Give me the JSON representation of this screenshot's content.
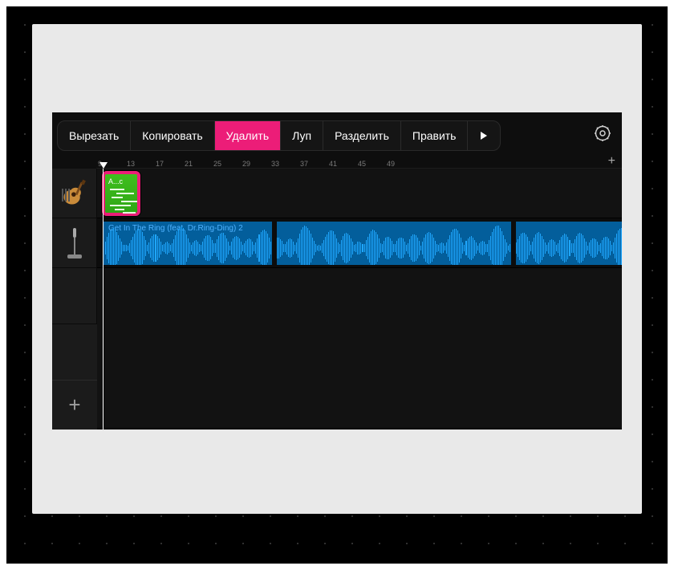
{
  "colors": {
    "accent": "#ec1d78",
    "clip_green": "#3fbf1e",
    "wave_blue": "#1fa7ff"
  },
  "context_menu": {
    "items": [
      {
        "label": "Вырезать",
        "highlighted": false
      },
      {
        "label": "Копировать",
        "highlighted": false
      },
      {
        "label": "Удалить",
        "highlighted": true
      },
      {
        "label": "Луп",
        "highlighted": false
      },
      {
        "label": "Разделить",
        "highlighted": false
      },
      {
        "label": "Править",
        "highlighted": false
      }
    ],
    "more_icon": "play-triangle"
  },
  "toolbar_icons": {
    "settings": "gear-icon"
  },
  "ruler": {
    "ticks": [
      "9",
      "13",
      "17",
      "21",
      "25",
      "29",
      "33",
      "37",
      "41",
      "45",
      "49"
    ],
    "add": "+"
  },
  "tracks": [
    {
      "icon": "acoustic-guitar",
      "clip": {
        "label": "A...c",
        "selected": true
      }
    },
    {
      "icon": "microphone",
      "clip": {
        "label": "Get In The Ring (feat. Dr.Ring-Ding) 2"
      }
    },
    {
      "icon": "grip"
    }
  ],
  "add_track_icon": "+"
}
